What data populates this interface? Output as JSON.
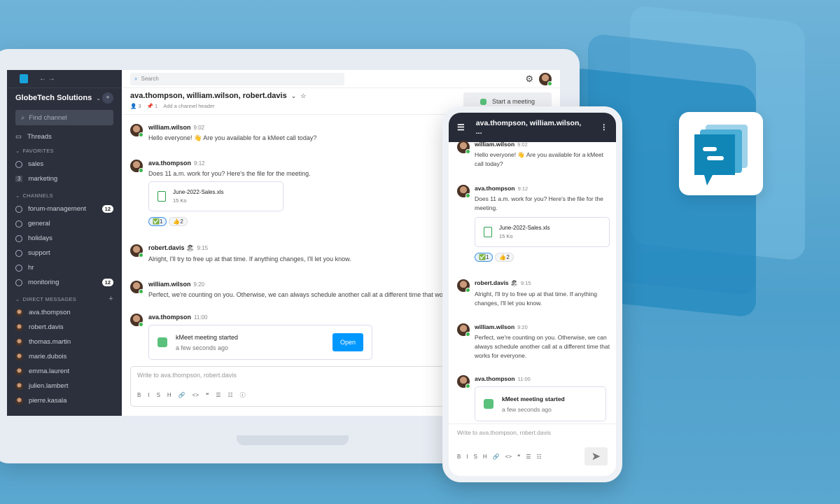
{
  "colors": {
    "accent": "#0098ff",
    "sidebar": "#2c303c",
    "online": "#3bb54a",
    "brand": "#0f86b6"
  },
  "sidebar": {
    "team": "GlobeTech Solutions",
    "find_placeholder": "Find channel",
    "threads": "Threads",
    "favorites_label": "FAVORITES",
    "favorites": [
      {
        "label": "sales",
        "icon": "globe-icon"
      },
      {
        "label": "marketing",
        "count": "3"
      }
    ],
    "channels_label": "CHANNELS",
    "channels": [
      {
        "label": "forum-management",
        "badge": "12"
      },
      {
        "label": "general"
      },
      {
        "label": "holidays"
      },
      {
        "label": "support"
      },
      {
        "label": "hr"
      },
      {
        "label": "monitoring",
        "badge": "12"
      }
    ],
    "dm_label": "DIRECT MESSAGES",
    "dms": [
      "ava.thompson",
      "robert.davis",
      "thomas.martin",
      "marie.dubois",
      "emma.laurent",
      "julien.lambert",
      "pierre.kasala"
    ]
  },
  "topbar": {
    "search_placeholder": "Search"
  },
  "channel": {
    "title": "ava.thompson, william.wilson, robert.davis",
    "members": "3",
    "pinned": "1",
    "header_link": "Add a channel header",
    "meeting_button": "Start a meeting"
  },
  "messages": [
    {
      "author": "william.wilson",
      "time": "9:02",
      "text": "Hello everyone! 👋 Are you available for a kMeet call today?"
    },
    {
      "author": "ava.thompson",
      "time": "9:12",
      "text": "Does 11 a.m. work for you? Here's the file for the meeting.",
      "file": {
        "name": "June-2022-Sales.xls",
        "size": "15 Ko"
      },
      "reactions": [
        {
          "emoji": "✅",
          "count": "1"
        },
        {
          "emoji": "👍",
          "count": "2"
        }
      ]
    },
    {
      "author": "robert.davis",
      "time": "9:15",
      "emoji": "🏖",
      "text": "Alright, I'll try to free up at that time. If anything changes, I'll let you know."
    },
    {
      "author": "william.wilson",
      "time": "9:20",
      "text": "Perfect, we're counting on you. Otherwise, we can always schedule another call at a different time that works for everyone."
    },
    {
      "author": "ava.thompson",
      "time": "11:00",
      "meeting": {
        "title": "kMeet meeting started",
        "sub": "a few seconds ago",
        "open": "Open"
      }
    }
  ],
  "composer": {
    "placeholder": "Write to ava.thompson, robert.davis",
    "format": [
      "B",
      "I",
      "S",
      "H",
      "🔗",
      "<>",
      "❝",
      "☰",
      "☷",
      "ⓘ"
    ]
  },
  "phone": {
    "title": "ava.thompson, william.wilson, ..."
  }
}
